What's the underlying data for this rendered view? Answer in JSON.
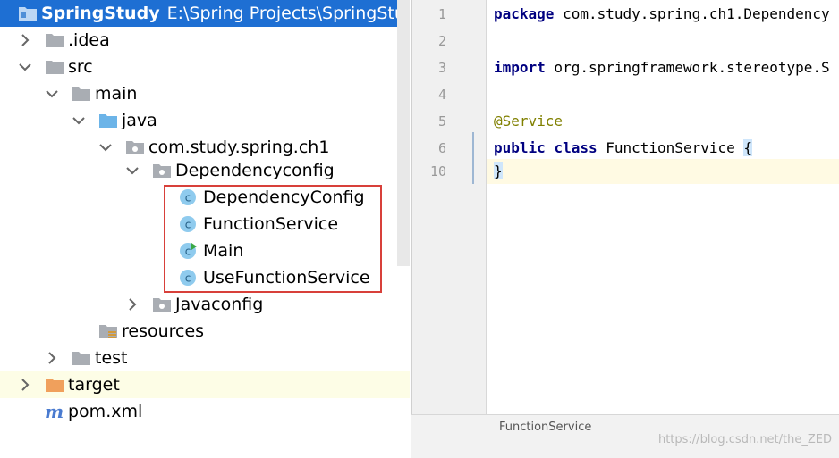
{
  "project": {
    "name": "SpringStudy",
    "path": "E:\\Spring Projects\\SpringStudy"
  },
  "tree": {
    "idea": ".idea",
    "src": "src",
    "main": "main",
    "java": "java",
    "package": "com.study.spring.ch1",
    "dependencyconfig": "Dependencyconfig",
    "classes": [
      "DependencyConfig",
      "FunctionService",
      "Main",
      "UseFunctionService"
    ],
    "javaconfig": "Javaconfig",
    "resources": "resources",
    "test": "test",
    "target": "target",
    "pom": "pom.xml"
  },
  "icons": {
    "class": "class-icon",
    "folder": "folder-icon",
    "package": "package-icon",
    "maven": "maven-icon"
  },
  "editor": {
    "line_numbers": [
      "1",
      "2",
      "3",
      "4",
      "5",
      "6",
      "10"
    ],
    "line1_kw": "package",
    "line1_rest": " com.study.spring.ch1.Dependency",
    "line3_kw": "import",
    "line3_rest": " org.springframework.stereotype.S",
    "line5": "@Service",
    "line6_kw1": "public",
    "line6_kw2": "class",
    "line6_rest": " FunctionService ",
    "brace_open": "{",
    "brace_close": "}"
  },
  "bottom": {
    "tab_label": "FunctionService",
    "watermark": "https://blog.csdn.net/the_ZED"
  },
  "colors": {
    "selection": "#1e6fd3",
    "highlight_box": "#d8403a",
    "keyword": "#000080",
    "annotation": "#808000"
  }
}
